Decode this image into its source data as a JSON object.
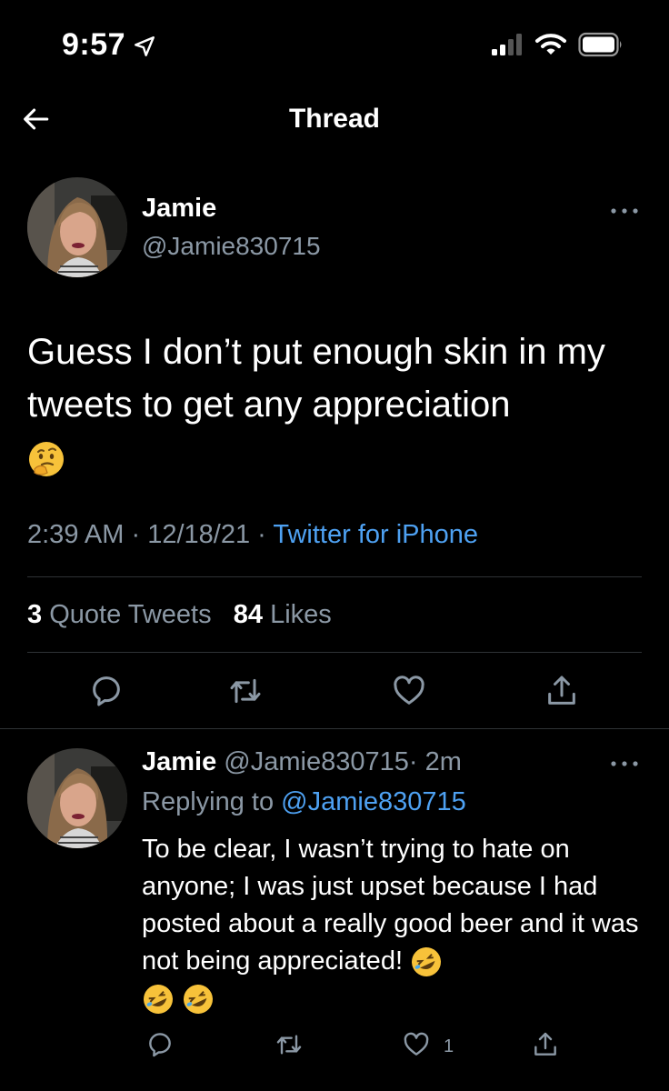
{
  "status_bar": {
    "time": "9:57"
  },
  "nav": {
    "title": "Thread"
  },
  "main_tweet": {
    "name": "Jamie",
    "handle": "@Jamie830715",
    "text": "Guess I don’t put enough skin in my tweets to get any appreciation",
    "text_emoji": "thinking-face",
    "time": "2:39 AM",
    "date": "12/18/21",
    "separator": "·",
    "source": "Twitter for iPhone",
    "quote_count": "3",
    "quote_label": "Quote Tweets",
    "like_count": "84",
    "like_label": "Likes"
  },
  "reply_tweet": {
    "name": "Jamie",
    "handle": "@Jamie830715",
    "age": "· 2m",
    "replying_label": "Replying to",
    "replying_to": "@Jamie830715",
    "text": "To be clear, I wasn’t trying to hate on anyone; I was just upset because I had posted about a really good beer and it was not being appreciated!",
    "text_emoji": "rolling-on-floor-laughing",
    "like_count": "1"
  },
  "colors": {
    "background": "#000000",
    "text": "#ffffff",
    "secondary": "#8b98a5",
    "link": "#4ea1f2",
    "divider": "#2f3336"
  }
}
